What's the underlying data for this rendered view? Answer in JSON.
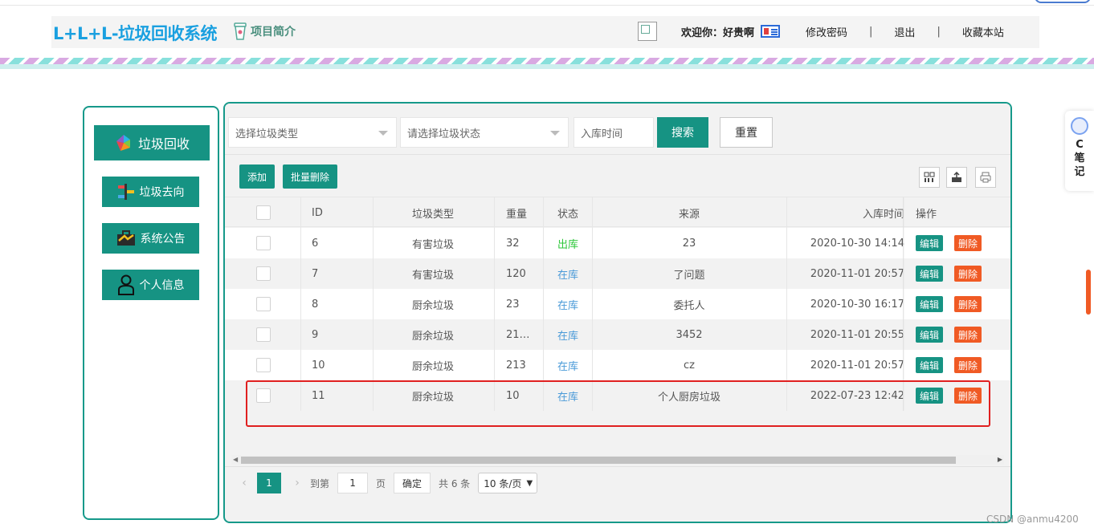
{
  "header": {
    "logo": "L+L+L-垃圾回收系统",
    "intro": "项目简介",
    "welcome": "欢迎你：好贵啊",
    "change_password": "修改密码",
    "sep1": "|",
    "logout": "退出",
    "sep2": "|",
    "bookmark": "收藏本站"
  },
  "sidebar": {
    "items": [
      {
        "label": "垃圾回收",
        "icon": "recycle-icon"
      },
      {
        "label": "垃圾去向",
        "icon": "direction-icon"
      },
      {
        "label": "系统公告",
        "icon": "briefcase-icon"
      },
      {
        "label": "个人信息",
        "icon": "user-icon"
      }
    ]
  },
  "search": {
    "type_placeholder": "选择垃圾类型",
    "status_placeholder": "请选择垃圾状态",
    "time_placeholder": "入库时间",
    "search_label": "搜索",
    "reset_label": "重置"
  },
  "toolbar": {
    "add_label": "添加",
    "batch_delete_label": "批量删除",
    "icons": [
      "columns-icon",
      "export-icon",
      "print-icon"
    ]
  },
  "table": {
    "headers": {
      "id": "ID",
      "type": "垃圾类型",
      "weight": "重量",
      "status": "状态",
      "source": "来源",
      "time": "入库时间",
      "ops": "操作"
    },
    "rows": [
      {
        "id": "6",
        "type": "有害垃圾",
        "weight": "32",
        "status": "出库",
        "source": "23",
        "time": "2020-10-30 14:14",
        "edit": "编辑",
        "del": "删除"
      },
      {
        "id": "7",
        "type": "有害垃圾",
        "weight": "120",
        "status": "在库",
        "source": "了问题",
        "time": "2020-11-01 20:57",
        "edit": "编辑",
        "del": "删除"
      },
      {
        "id": "8",
        "type": "厨余垃圾",
        "weight": "23",
        "status": "在库",
        "source": "委托人",
        "time": "2020-10-30 16:17",
        "edit": "编辑",
        "del": "删除"
      },
      {
        "id": "9",
        "type": "厨余垃圾",
        "weight": "21…",
        "status": "在库",
        "source": "3452",
        "time": "2020-11-01 20:55",
        "edit": "编辑",
        "del": "删除"
      },
      {
        "id": "10",
        "type": "厨余垃圾",
        "weight": "213",
        "status": "在库",
        "source": "cz",
        "time": "2020-11-01 20:57",
        "edit": "编辑",
        "del": "删除"
      },
      {
        "id": "11",
        "type": "厨余垃圾",
        "weight": "10",
        "status": "在库",
        "source": "个人厨房垃圾",
        "time": "2022-07-23 12:42",
        "edit": "编辑",
        "del": "删除"
      }
    ]
  },
  "pager": {
    "prev": "‹",
    "current": "1",
    "next": "›",
    "goto": "到第",
    "page_input": "1",
    "page_unit": "页",
    "confirm": "确定",
    "total": "共 6 条",
    "page_size": "10 条/页"
  },
  "side_widget": {
    "line1": "C",
    "line2": "笔",
    "line3": "记"
  },
  "watermark": "CSDN @anmu4200",
  "colors": {
    "primary": "#169383",
    "danger": "#f05a24",
    "logo": "#1aa0e0",
    "status_out": "#2ec73a",
    "status_in": "#4a9ad8",
    "highlight_box": "#e02020"
  }
}
